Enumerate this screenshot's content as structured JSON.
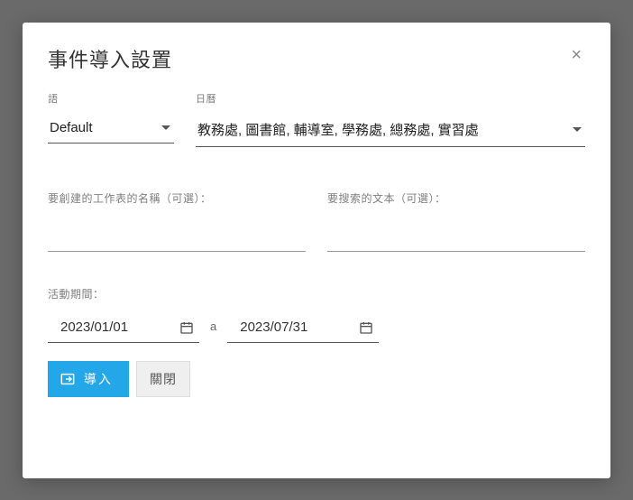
{
  "modal": {
    "title": "事件導入設置",
    "close_glyph": "×"
  },
  "language": {
    "label": "語",
    "value": "Default"
  },
  "calendar": {
    "label": "日曆",
    "value": "教務處, 圖書館, 輔導室, 學務處, 總務處, 實習處"
  },
  "sheet_name": {
    "label": "要創建的工作表的名稱（可選）："
  },
  "search_text": {
    "label": "要搜索的文本（可選）："
  },
  "period": {
    "label": "活動期間：",
    "start": "2023/01/01",
    "separator": "a",
    "end": "2023/07/31"
  },
  "buttons": {
    "import": "導入",
    "close": "關閉"
  }
}
